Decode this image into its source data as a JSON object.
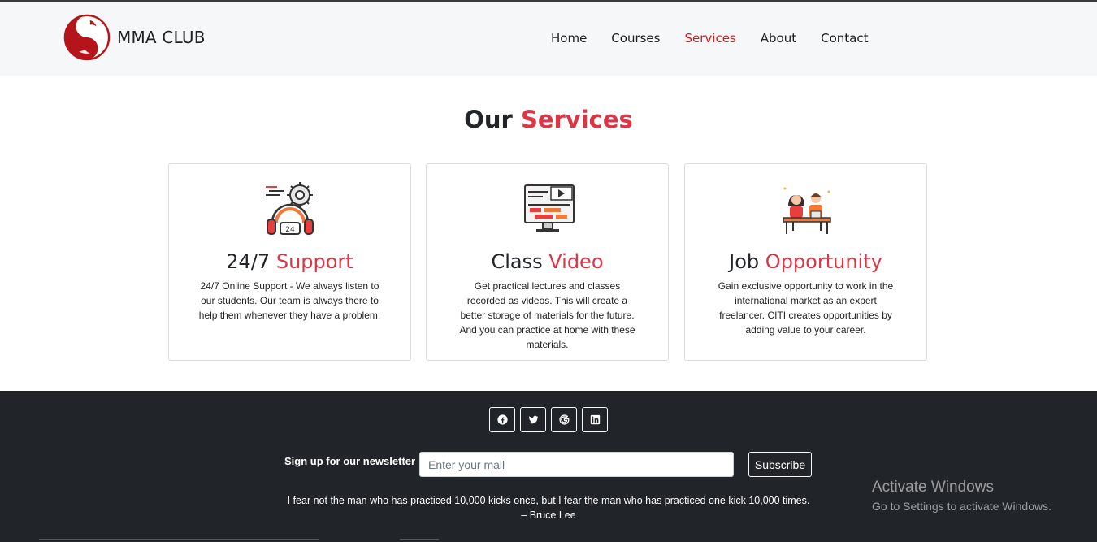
{
  "brand": {
    "name": "MMA CLUB",
    "logo": "yin-yang-dragon-logo"
  },
  "nav": {
    "items": [
      {
        "label": "Home",
        "active": false
      },
      {
        "label": "Courses",
        "active": false
      },
      {
        "label": "Services",
        "active": true
      },
      {
        "label": "About",
        "active": false
      },
      {
        "label": "Contact",
        "active": false
      }
    ]
  },
  "services": {
    "heading_plain": "Our",
    "heading_accent": "Services",
    "cards": [
      {
        "icon": "headset-24-support-icon",
        "title_plain": "24/7",
        "title_accent": "Support",
        "desc": "24/7 Online Support - We always listen to our students. Our team is always there to help them whenever they have a problem."
      },
      {
        "icon": "video-class-monitor-icon",
        "title_plain": "Class",
        "title_accent": "Video",
        "desc": "Get practical lectures and classes recorded as videos. This will create a better storage of materials for the future. And you can practice at home with these materials."
      },
      {
        "icon": "job-meeting-people-icon",
        "title_plain": "Job",
        "title_accent": "Opportunity",
        "desc": "Gain exclusive opportunity to work in the international market as an expert freelancer. CITI creates opportunities by adding value to your career."
      }
    ]
  },
  "footer": {
    "socials": [
      "facebook-icon",
      "twitter-icon",
      "google-icon",
      "linkedin-icon"
    ],
    "newsletter_label": "Sign up for our newsletter",
    "email_placeholder": "Enter your mail",
    "subscribe_label": "Subscribe",
    "quote": "I fear not the man who has practiced 10,000 kicks once, but I fear the man who has practiced one kick 10,000 times.",
    "quote_author": "– Bruce Lee"
  },
  "watermark": {
    "line1": "Activate Windows",
    "line2": "Go to Settings to activate Windows."
  },
  "colors": {
    "accent": "#dc3545",
    "nav_active": "#d61b1b",
    "footer_bg": "#212529",
    "navbar_bg": "#f6f7f8"
  }
}
